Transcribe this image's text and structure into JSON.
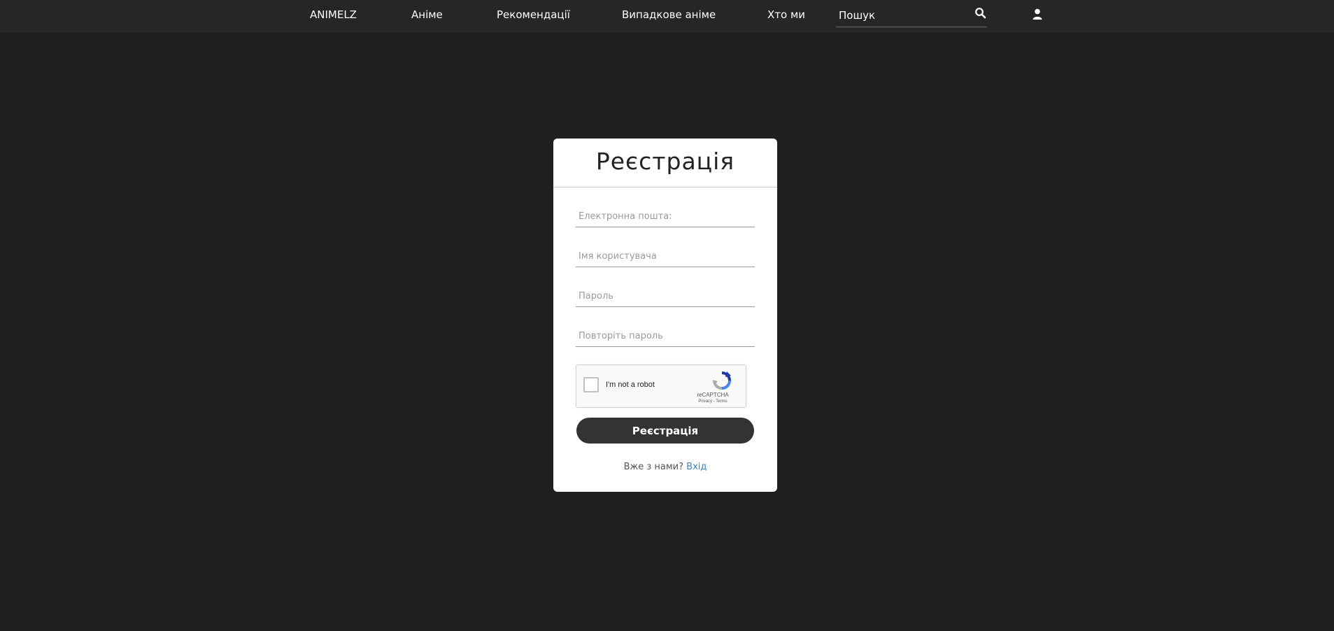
{
  "nav": {
    "brand": "ANIMELZ",
    "anime": "Аніме",
    "recommendations": "Рекомендації",
    "random": "Випадкове аніме",
    "about": "Хто ми",
    "search_placeholder": "Пошук",
    "search_icon": "search-icon",
    "user_icon": "user-icon"
  },
  "form": {
    "title": "Реєстрація",
    "email_placeholder": "Електронна пошта:",
    "username_placeholder": "Імя користувача",
    "password_placeholder": "Пароль",
    "password_repeat_placeholder": "Повторіть пароль",
    "submit_label": "Реєстрація",
    "already_text": "Вже з нами?",
    "login_link": "Вхід"
  },
  "recaptcha": {
    "label": "I'm not a robot",
    "brand": "reCAPTCHA",
    "privacy": "Privacy",
    "separator": "-",
    "terms": "Terms"
  },
  "colors": {
    "background": "#202020",
    "topbar": "#262626",
    "card": "#ffffff",
    "button": "#333333",
    "link": "#3d86c4"
  }
}
